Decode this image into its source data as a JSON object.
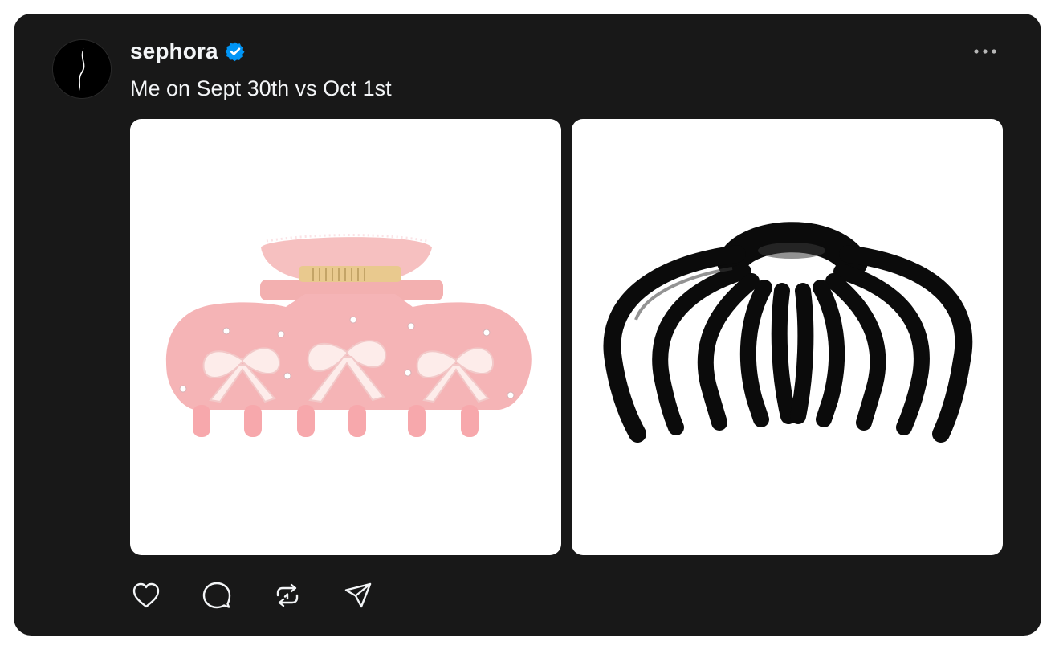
{
  "post": {
    "username": "sephora",
    "verified": true,
    "caption": "Me on Sept 30th vs Oct 1st",
    "avatar_icon": "sephora-logo-icon",
    "more_icon": "more-horizontal-icon",
    "media": [
      {
        "name": "pink-bow-claw-clip",
        "bg": "#ffffff",
        "accent": "#f4b7b9"
      },
      {
        "name": "black-octopus-claw-clip",
        "bg": "#ffffff",
        "accent": "#0b0b0b"
      }
    ],
    "actions": [
      {
        "icon": "heart-icon",
        "label": "Like"
      },
      {
        "icon": "comment-icon",
        "label": "Reply"
      },
      {
        "icon": "repost-icon",
        "label": "Repost"
      },
      {
        "icon": "share-icon",
        "label": "Share"
      }
    ]
  },
  "colors": {
    "card_bg": "#181818",
    "text": "#f3f5f7",
    "muted": "#b8b8b8",
    "verified_blue": "#0095f6"
  }
}
